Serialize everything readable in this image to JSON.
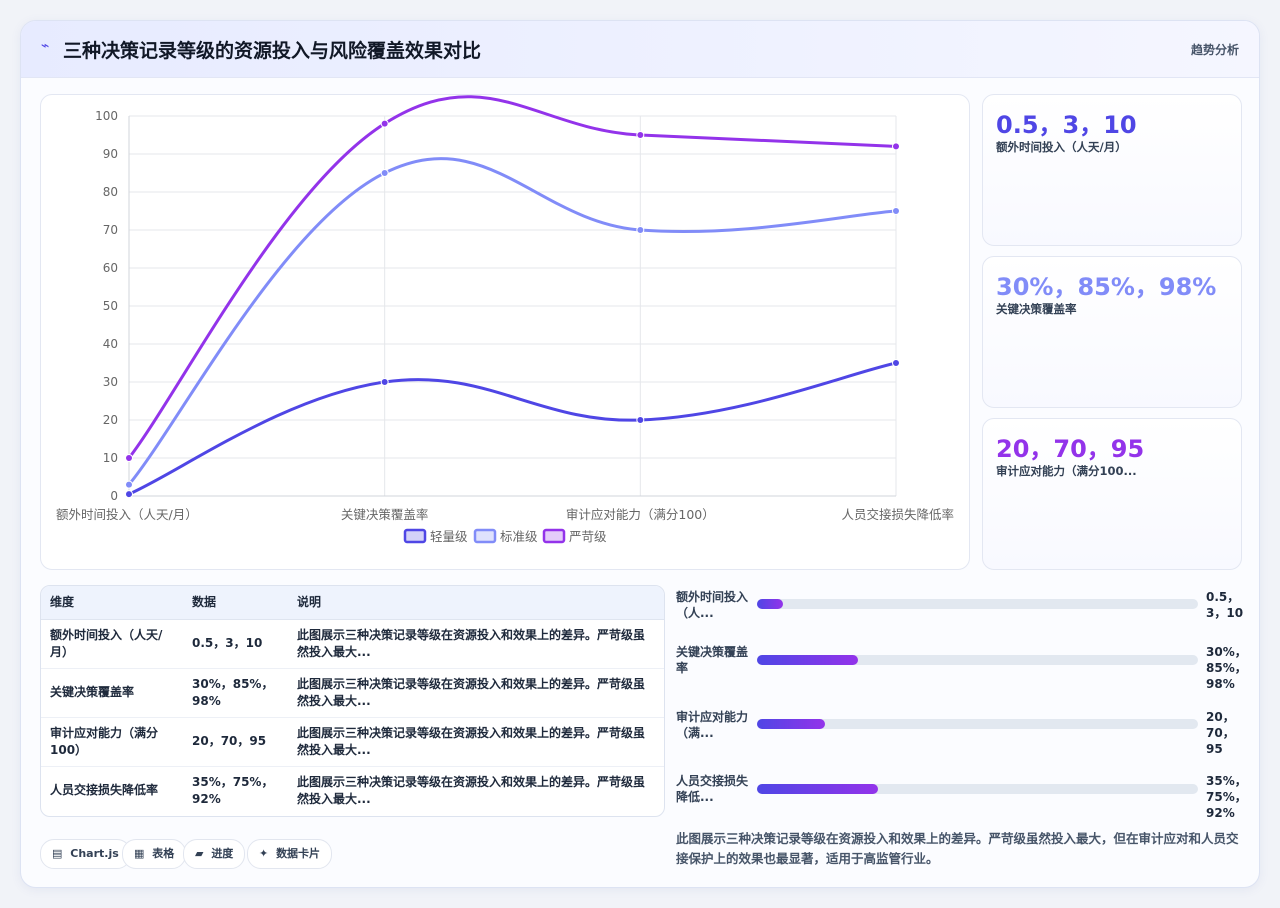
{
  "header": {
    "icon": "trend-icon",
    "title": "三种决策记录等级的资源投入与风险覆盖效果对比",
    "action_label": "趋势分析"
  },
  "colors": {
    "series": [
      "#4f46e5",
      "#818cf8",
      "#9333ea"
    ],
    "grid": "#e5e7eb",
    "axis_text": "#666666"
  },
  "chart_data": {
    "type": "line",
    "categories": [
      "额外时间投入（人天/月）",
      "关键决策覆盖率",
      "审计应对能力（满分100）",
      "人员交接损失降低率"
    ],
    "series": [
      {
        "name": "轻量级",
        "values": [
          0.5,
          30,
          20,
          35
        ]
      },
      {
        "name": "标准级",
        "values": [
          3,
          85,
          70,
          75
        ]
      },
      {
        "name": "严苛级",
        "values": [
          10,
          98,
          95,
          92
        ]
      }
    ],
    "yticks": [
      "100",
      "90",
      "80",
      "70",
      "60",
      "50",
      "40",
      "30",
      "20",
      "10",
      "0"
    ],
    "ylim": [
      0,
      100
    ],
    "grid": true,
    "legend_position": "bottom"
  },
  "stats": [
    {
      "value": "0.5，3，10",
      "label": "额外时间投入（人天/月）",
      "color": "#4f46e5"
    },
    {
      "value": "30%，85%，98%",
      "label": "关键决策覆盖率",
      "color": "#818cf8"
    },
    {
      "value": "20，70，95",
      "label": "审计应对能力（满分100...",
      "color": "#9333ea"
    }
  ],
  "table": {
    "headers": [
      "维度",
      "数据",
      "说明"
    ],
    "rows": [
      {
        "dim": "额外时间投入（人天/月）",
        "data": "0.5，3，10",
        "desc": "此图展示三种决策记录等级在资源投入和效果上的差异。严苛级虽然投入最大..."
      },
      {
        "dim": "关键决策覆盖率",
        "data": "30%，85%，98%",
        "desc": "此图展示三种决策记录等级在资源投入和效果上的差异。严苛级虽然投入最大..."
      },
      {
        "dim": "审计应对能力（满分100）",
        "data": "20，70，95",
        "desc": "此图展示三种决策记录等级在资源投入和效果上的差异。严苛级虽然投入最大..."
      },
      {
        "dim": "人员交接损失降低率",
        "data": "35%，75%，92%",
        "desc": "此图展示三种决策记录等级在资源投入和效果上的差异。严苛级虽然投入最大..."
      }
    ]
  },
  "chips": [
    {
      "icon": "chart-icon",
      "glyph": "▤",
      "label": "Chart.js"
    },
    {
      "icon": "table-icon",
      "glyph": "▦",
      "label": "表格"
    },
    {
      "icon": "folder-icon",
      "glyph": "▰",
      "label": "进度"
    },
    {
      "icon": "sparkle-icon",
      "glyph": "✦",
      "label": "数据卡片"
    }
  ],
  "progress": [
    {
      "label": "额外时间投入（人...",
      "value": "0.5，3，10",
      "fill": 0.06
    },
    {
      "label": "关键决策覆盖率",
      "value": "30%，85%，98%",
      "fill": 0.23
    },
    {
      "label": "审计应对能力（满...",
      "value": "20，70，95",
      "fill": 0.155
    },
    {
      "label": "人员交接损失降低...",
      "value": "35%，75%，92%",
      "fill": 0.275
    }
  ],
  "note": "此图展示三种决策记录等级在资源投入和效果上的差异。严苛级虽然投入最大，但在审计应对和人员交接保护上的效果也最显著，适用于高监管行业。"
}
